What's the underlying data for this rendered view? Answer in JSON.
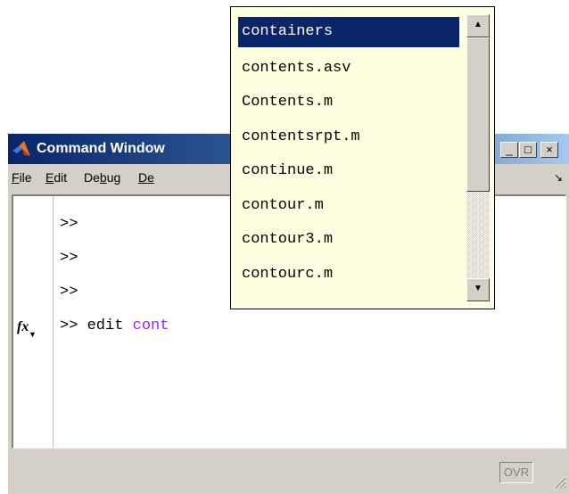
{
  "window": {
    "title": "Command Window",
    "controls": {
      "minimize": "_",
      "maximize": "□",
      "close": "×"
    },
    "icon": "matlab-logo-icon"
  },
  "menu": {
    "items": [
      {
        "label_first": "F",
        "label_rest": "ile"
      },
      {
        "label_first": "E",
        "label_rest": "dit"
      },
      {
        "label_pre": "De",
        "label_ul": "b",
        "label_post": "ug"
      },
      {
        "label_first": "De",
        "label_rest": ""
      }
    ],
    "undock_icon": "↘"
  },
  "console": {
    "prompt": ">>",
    "lines": [
      ">>",
      ">>",
      ">>"
    ],
    "current_command": "edit ",
    "current_partial": "cont",
    "fx_label": "fx",
    "partial_color": "#a020f0"
  },
  "autocomplete": {
    "items": [
      "containers",
      "contents.asv",
      "Contents.m",
      "contentsrpt.m",
      "continue.m",
      "contour.m",
      "contour3.m",
      "contourc.m"
    ],
    "selected_index": 0,
    "background": "#ffffe1",
    "selection_color": "#0a246a"
  },
  "status": {
    "ovr": "OVR"
  }
}
